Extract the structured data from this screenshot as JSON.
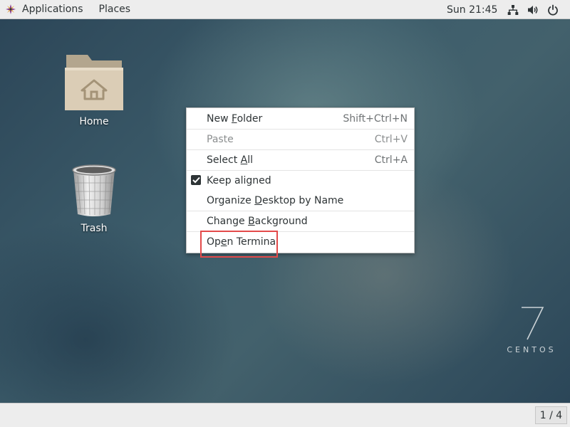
{
  "topbar": {
    "applications_label": "Applications",
    "places_label": "Places",
    "clock": "Sun 21:45"
  },
  "desktop": {
    "icons": [
      {
        "label": "Home",
        "icon": "folder-home-icon"
      },
      {
        "label": "Trash",
        "icon": "trash-icon"
      }
    ],
    "brand": {
      "numeral": "7",
      "word": "CENTOS"
    }
  },
  "context_menu": {
    "items": [
      {
        "label": "New Folder",
        "shortcut": "Shift+Ctrl+N",
        "mnemonic": "F",
        "enabled": true
      },
      {
        "label": "Paste",
        "shortcut": "Ctrl+V",
        "enabled": false
      },
      {
        "label": "Select All",
        "shortcut": "Ctrl+A",
        "mnemonic": "A",
        "enabled": true
      },
      {
        "label": "Keep aligned",
        "checked": true,
        "enabled": true
      },
      {
        "label": "Organize Desktop by Name",
        "mnemonic": "D",
        "enabled": true
      },
      {
        "label": "Change Background",
        "mnemonic": "B",
        "enabled": true
      },
      {
        "label": "Open Terminal",
        "mnemonic": "e",
        "enabled": true,
        "highlighted": true
      }
    ]
  },
  "bottombar": {
    "workspace_indicator": "1 / 4"
  },
  "colors": {
    "panel_bg": "#ededed",
    "menu_bg": "#ffffff",
    "highlight_border": "#e34a4a",
    "text": "#2e3436"
  }
}
